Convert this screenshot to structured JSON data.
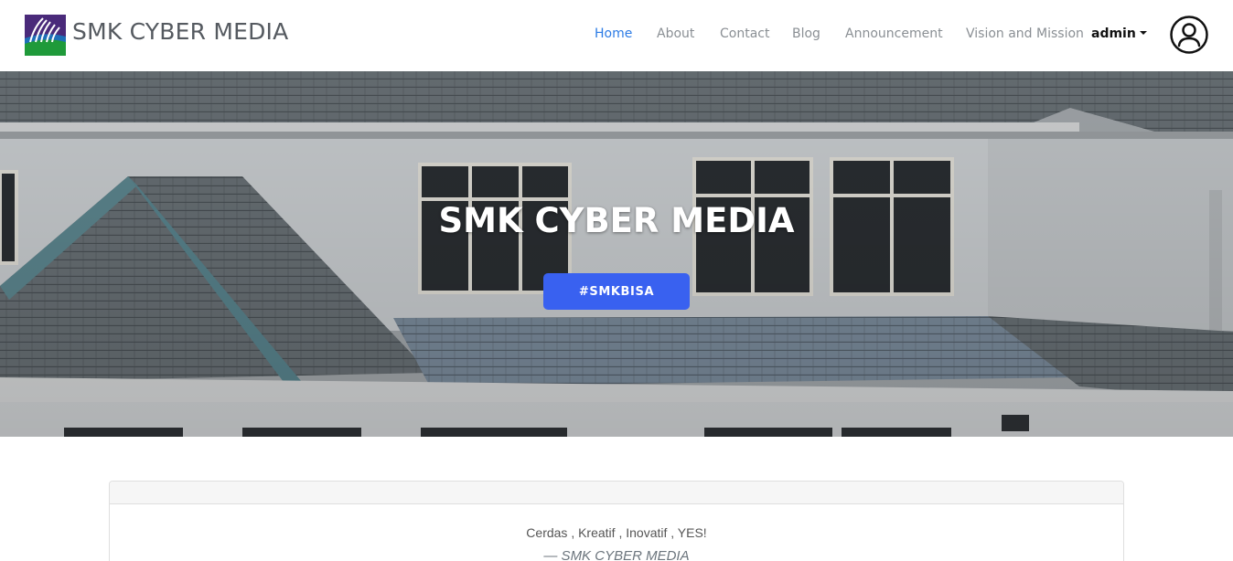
{
  "brand": {
    "name": "SMK CYBER MEDIA",
    "logo_icon": "school-logo-icon"
  },
  "nav": {
    "items": [
      {
        "label": "Home",
        "active": true
      },
      {
        "label": "About",
        "active": false
      },
      {
        "label": "Contact",
        "active": false
      },
      {
        "label": "Blog",
        "active": false
      },
      {
        "label": "Announcement",
        "active": false
      },
      {
        "label": "Vision and Mission",
        "active": false
      }
    ],
    "user": {
      "label": "admin",
      "icon": "user-avatar-icon"
    }
  },
  "hero": {
    "title": "SMK CYBER MEDIA",
    "button_label": "#SMKBISA"
  },
  "quote": {
    "text": "Cerdas , Kreatif , Inovatif , YES!",
    "footer": "— SMK CYBER MEDIA"
  },
  "colors": {
    "accent": "#2c7be5",
    "button": "#3961f0",
    "nav_text": "#8a8f94"
  }
}
